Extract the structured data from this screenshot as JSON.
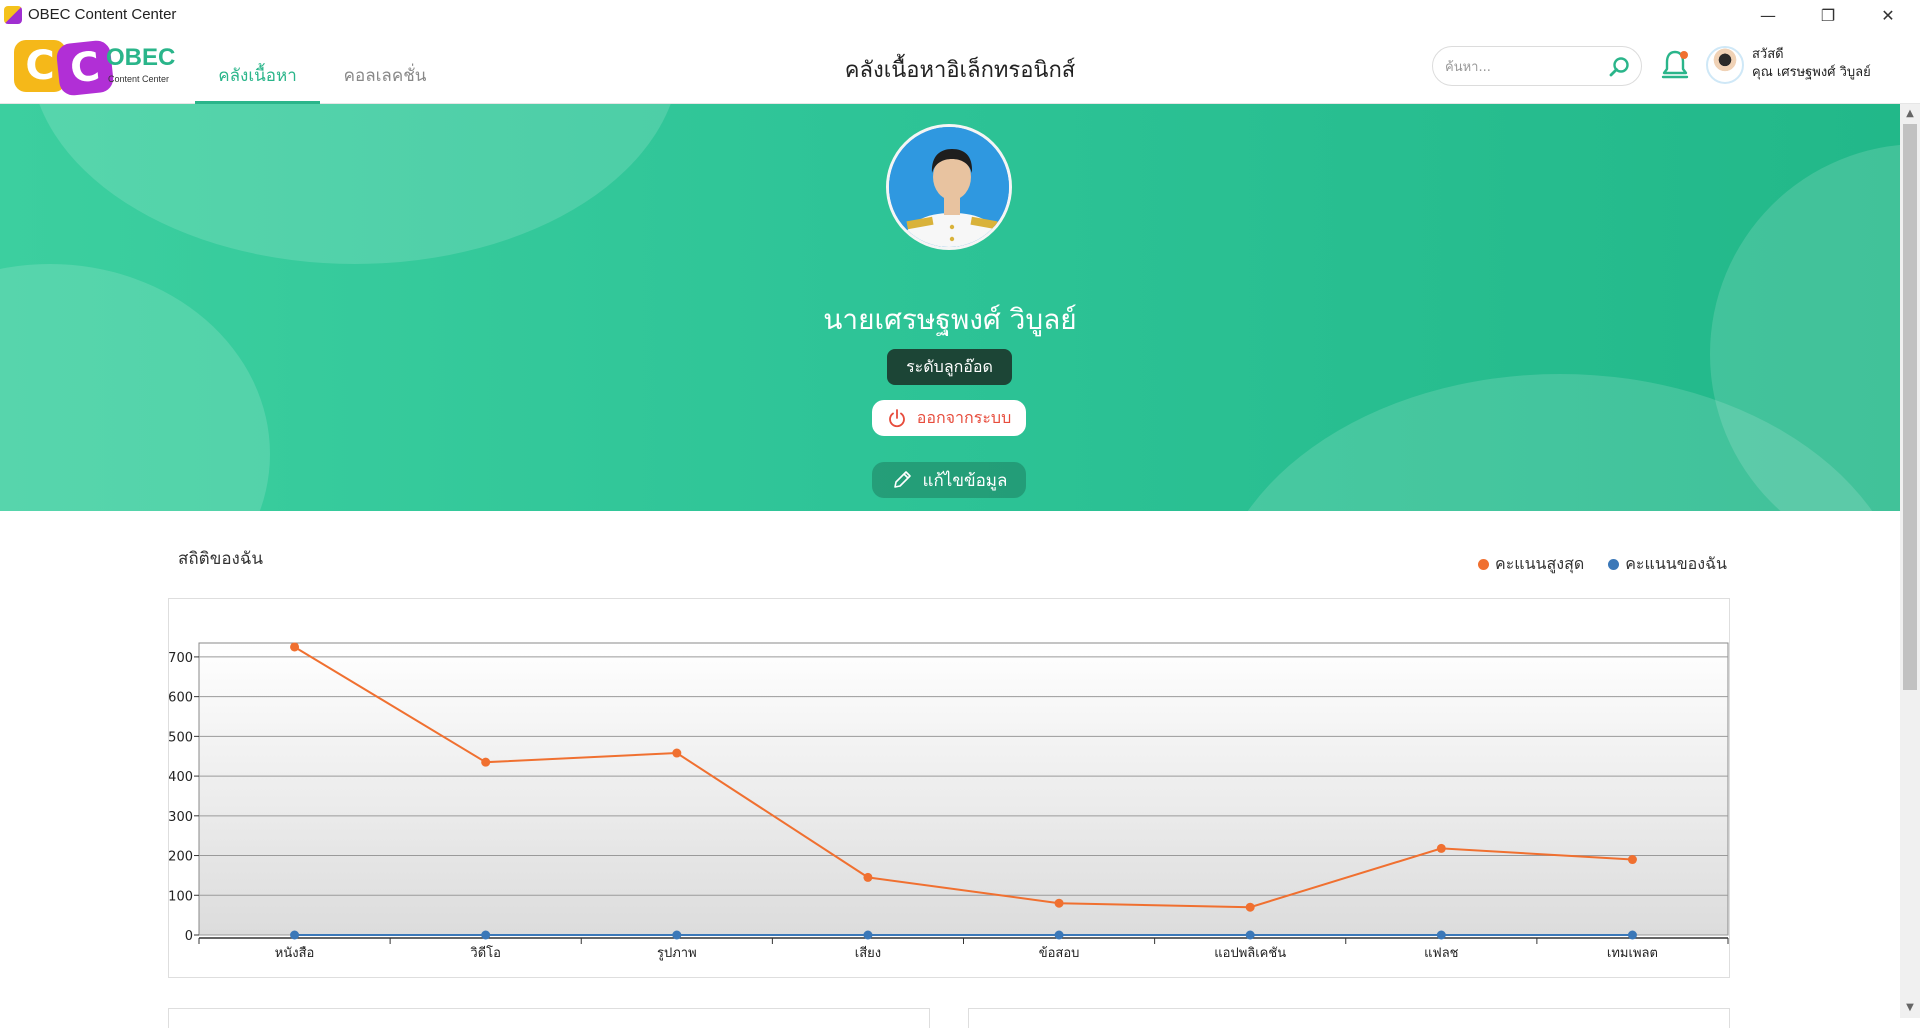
{
  "window": {
    "title": "OBEC Content Center",
    "controls": {
      "minimize": "—",
      "maximize": "❐",
      "close": "✕"
    }
  },
  "logo": {
    "letters": [
      "C",
      "C"
    ],
    "brand": "OBEC",
    "sub": "Content Center"
  },
  "nav": {
    "tabs": [
      {
        "label": "คลังเนื้อหา",
        "active": true
      },
      {
        "label": "คอลเลคชั่น",
        "active": false
      }
    ]
  },
  "header": {
    "title": "คลังเนื้อหาอิเล็กทรอนิกส์",
    "search_placeholder": "ค้นหา...",
    "greeting": "สวัสดี",
    "user_short": "คุณ เศรษฐพงศ์ วิบูลย์"
  },
  "profile": {
    "name": "นายเศรษฐพงศ์ วิบูลย์",
    "rank": "ระดับลูกอ๊อด",
    "logout_label": "ออกจากระบบ",
    "edit_label": "แก้ไขข้อมูล"
  },
  "stats": {
    "title": "สถิติของฉัน"
  },
  "colors": {
    "accent": "#2ab58a",
    "hero_start": "#3ccf9f",
    "hero_end": "#22b889",
    "series_max": "#f07030",
    "series_mine": "#3b78b8",
    "logout": "#e74c3c"
  },
  "chart_data": {
    "type": "line",
    "categories": [
      "หนังสือ",
      "วิดีโอ",
      "รูปภาพ",
      "เสียง",
      "ข้อสอบ",
      "แอปพลิเคชัน",
      "แฟลช",
      "เทมเพลต"
    ],
    "series": [
      {
        "name": "คะแนนสูงสุด",
        "color": "#f07030",
        "values": [
          725,
          435,
          458,
          145,
          80,
          70,
          218,
          190
        ]
      },
      {
        "name": "คะแนนของฉัน",
        "color": "#3b78b8",
        "values": [
          0,
          0,
          0,
          0,
          0,
          0,
          0,
          0
        ]
      }
    ],
    "yticks": [
      0,
      100,
      200,
      300,
      400,
      500,
      600,
      700
    ],
    "ylim": [
      0,
      735
    ],
    "grid": true,
    "legend": "top-right"
  }
}
